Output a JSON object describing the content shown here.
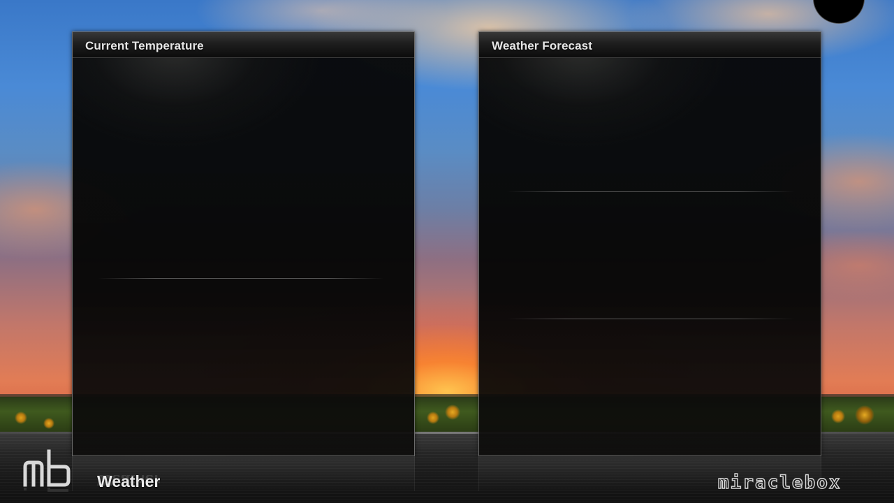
{
  "panels": {
    "current": {
      "title": "Current Temperature"
    },
    "forecast": {
      "title": "Weather Forecast"
    }
  },
  "footer": {
    "section_title": "Weather",
    "brand": "miraclebox",
    "logo": "mb-logo"
  },
  "colors": {
    "panel_bg": "#080808",
    "title_text": "#e6e6e6",
    "sky_top": "#3a78c8",
    "sunset_orange": "#e27c55"
  }
}
